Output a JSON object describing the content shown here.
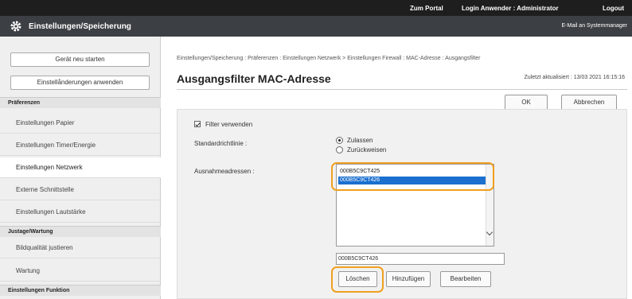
{
  "topbar": {
    "portal": "Zum Portal",
    "login": "Login Anwender : Administrator",
    "logout": "Logout"
  },
  "header": {
    "title": "Einstellungen/Speicherung",
    "mail": "E-Mail an Systemmanager"
  },
  "sidebar": {
    "restart_btn": "Gerät neu starten",
    "apply_btn": "Einstellånderungen anwenden",
    "sections": [
      {
        "title": "Präferenzen",
        "items": [
          "Einstellungen Papier",
          "Einstellungen Timer/Energie",
          "Einstellungen Netzwerk",
          "Externe Schnittstelle",
          "Einstellungen Lautstärke"
        ]
      },
      {
        "title": "Justage/Wartung",
        "items": [
          "Bildqualität justieren",
          "Wartung"
        ]
      },
      {
        "title": "Einstellungen Funktion",
        "items": []
      }
    ],
    "active_item": "Einstellungen Netzwerk"
  },
  "main": {
    "breadcrumb": "Einstellungen/Speicherung : Präferenzen : Einstellungen Netzwerk > Einstellungen Firewall : MAC-Adresse : Ausgangsfilter",
    "title": "Ausgangsfilter MAC-Adresse",
    "updated": "Zuletzt aktualisiert : 13/03 2021 16:15:16",
    "ok_btn": "OK",
    "cancel_btn": "Abbrechen",
    "use_filter_label": "Filter verwenden",
    "default_policy_label": "Standardrichtlinie :",
    "policy_allow": "Zulassen",
    "policy_deny": "Zurückweisen",
    "exceptions_label": "Ausnahmeadressen :",
    "addresses": [
      "000B5C9CT425",
      "000B5C9CT426"
    ],
    "selected_address": "000B5C9CT426",
    "input_value": "000B5C9CT426",
    "delete_btn": "Löschen",
    "add_btn": "Hinzufügen",
    "edit_btn": "Bearbeiten"
  },
  "colors": {
    "topbar": "#1e1e1e",
    "titlebar": "#3c3f43",
    "selection": "#1a6fcf",
    "highlight": "#f0a020"
  }
}
